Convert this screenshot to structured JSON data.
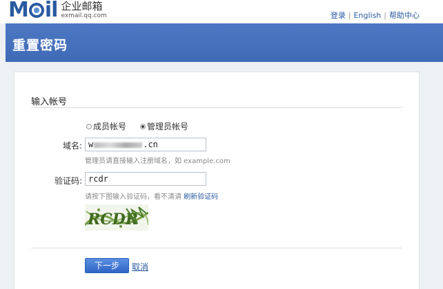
{
  "header": {
    "logo_mark": "Mail",
    "logo_cn": "企业邮箱",
    "logo_url": "exmail.qq.com",
    "links": {
      "login": "登录",
      "english": "English",
      "help": "帮助中心"
    }
  },
  "banner": {
    "title": "重置密码"
  },
  "form": {
    "section_title": "输入帐号",
    "account_types": [
      {
        "label": "成员帐号",
        "checked": false
      },
      {
        "label": "管理员帐号",
        "checked": true
      }
    ],
    "domain": {
      "label": "域名:",
      "value_prefix": "w",
      "value_suffix": ".cn",
      "hint": "管理员请直接输入注册域名，如 example.com"
    },
    "captcha": {
      "label": "验证码:",
      "value": "rcdr",
      "hint": "请按下图输入验证码，看不清请",
      "refresh_link": "刷新验证码",
      "image_text": "RCDR"
    },
    "next_button": "下一步",
    "cancel_link": "取消"
  },
  "colors": {
    "accent": "#2a5aa0",
    "banner": "#4571bd",
    "button": "#3a73d4"
  }
}
